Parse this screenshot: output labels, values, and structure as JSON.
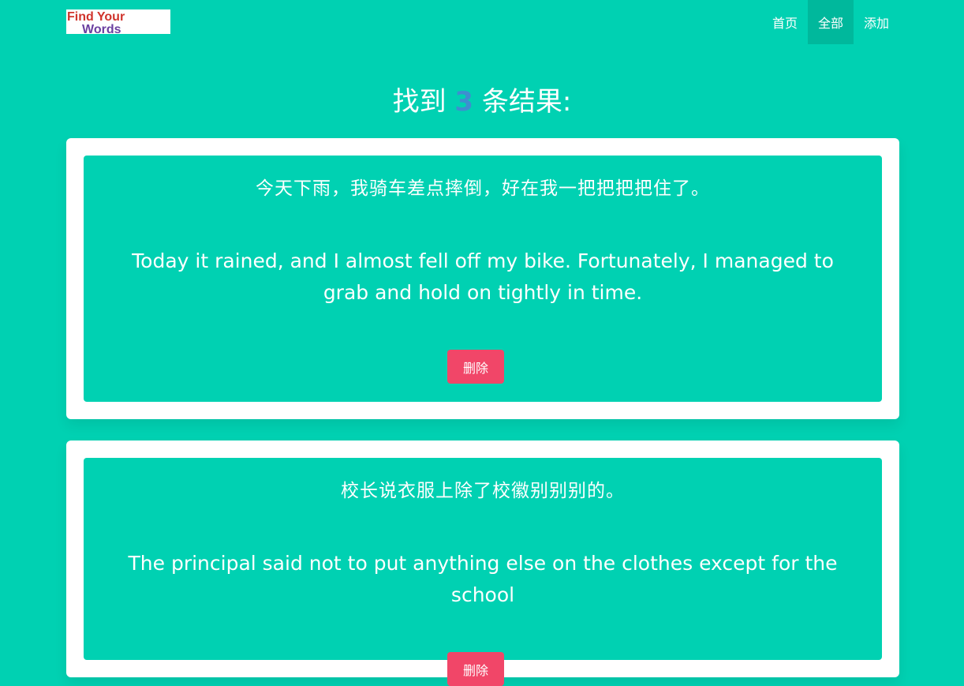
{
  "nav": {
    "logo_text_line1": "Find Your",
    "logo_text_line2": "Words",
    "items": [
      {
        "label": "首页",
        "active": false
      },
      {
        "label": "全部",
        "active": true
      },
      {
        "label": "添加",
        "active": false
      }
    ]
  },
  "results": {
    "prefix": "找到",
    "count": "3",
    "suffix": "条结果:"
  },
  "cards": [
    {
      "chinese": "今天下雨，我骑车差点摔倒，好在我一把把把把住了。",
      "english": "Today it rained, and I almost fell off my bike. Fortunately, I managed to grab and hold on tightly in time.",
      "delete_label": "删除"
    },
    {
      "chinese": "校长说衣服上除了校徽别别别的。",
      "english": "The principal said not to put anything else on the clothes except for the school",
      "delete_label": "删除"
    }
  ],
  "colors": {
    "primary": "#00d1b2",
    "count": "#3e8ed0",
    "danger": "#f14668",
    "active_nav": "#00b89c"
  }
}
